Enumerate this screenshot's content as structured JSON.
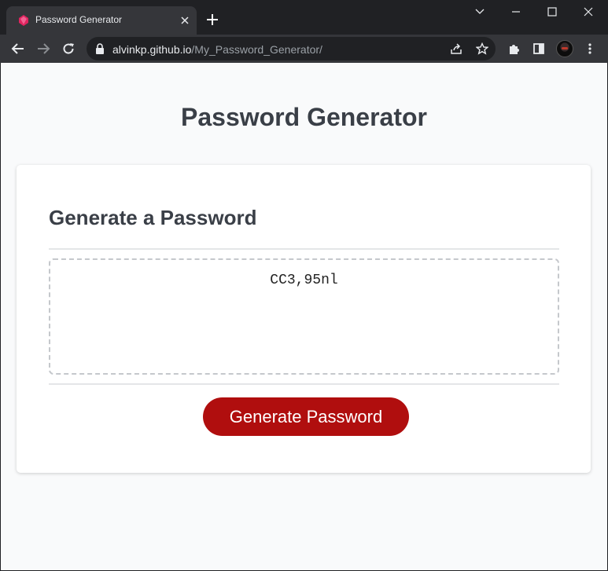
{
  "browser": {
    "tab": {
      "title": "Password Generator"
    },
    "address_bar": {
      "host": "alvinkp.github.io",
      "path": "/My_Password_Generator/"
    },
    "icons": [
      "tab-search-icon",
      "minimize-icon",
      "maximize-icon",
      "close-window-icon",
      "back-icon",
      "forward-icon",
      "reload-icon",
      "lock-icon",
      "share-icon",
      "bookmark-star-icon",
      "extensions-icon",
      "side-panel-icon",
      "menu-icon"
    ]
  },
  "page": {
    "title": "Password Generator",
    "card": {
      "header": "Generate a Password",
      "password_value": "CC3,95nl",
      "button_label": "Generate Password"
    }
  },
  "colors": {
    "accent": "#b00e0e",
    "page_background": "#f9fafb",
    "heading": "#3a3f47",
    "chrome_dark": "#202124",
    "chrome_toolbar": "#35363a"
  }
}
